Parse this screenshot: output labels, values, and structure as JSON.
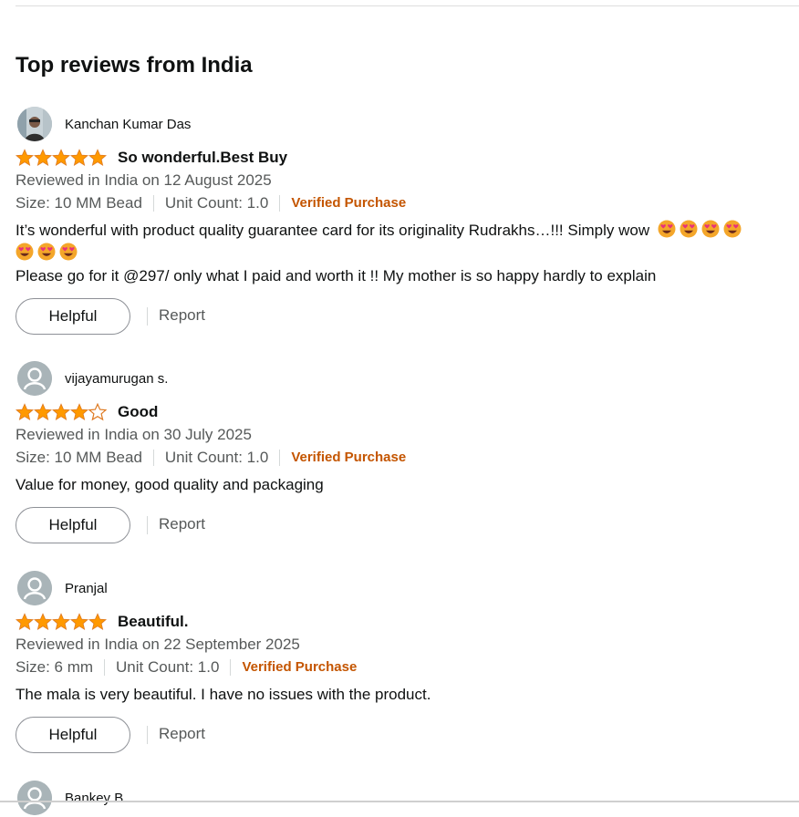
{
  "section_title": "Top reviews from India",
  "colors": {
    "star": "#ff9900",
    "star_outline": "#de7921",
    "verified": "#c45500",
    "muted_text": "#565959",
    "emoji": "#e8327a"
  },
  "reviews": [
    {
      "reviewer": "Kanchan Kumar Das",
      "rating": 5,
      "title": "So wonderful.Best Buy",
      "date": "Reviewed in India on 12 August 2025",
      "size": "Size: 10 MM Bead",
      "unit_count": "Unit Count: 1.0",
      "verified": "Verified Purchase",
      "body_line1": "It’s wonderful with product quality guarantee card for its originality Rudrakhs…!!! Simply wow",
      "body_line2": "Please go for it @297/ only what I paid and worth it !! My mother is so happy hardly to explain",
      "helpful": "Helpful",
      "report": "Report"
    },
    {
      "reviewer": "vijayamurugan s.",
      "rating": 4,
      "title": "Good",
      "date": "Reviewed in India on 30 July 2025",
      "size": "Size: 10 MM Bead",
      "unit_count": "Unit Count: 1.0",
      "verified": "Verified Purchase",
      "body": "Value for money, good quality and packaging",
      "helpful": "Helpful",
      "report": "Report"
    },
    {
      "reviewer": "Pranjal",
      "rating": 5,
      "title": "Beautiful.",
      "date": "Reviewed in India on 22 September 2025",
      "size": "Size: 6 mm",
      "unit_count": "Unit Count: 1.0",
      "verified": "Verified Purchase",
      "body": "The mala is very beautiful. I have no issues with the product.",
      "helpful": "Helpful",
      "report": "Report"
    },
    {
      "reviewer": "Bankey B"
    }
  ]
}
